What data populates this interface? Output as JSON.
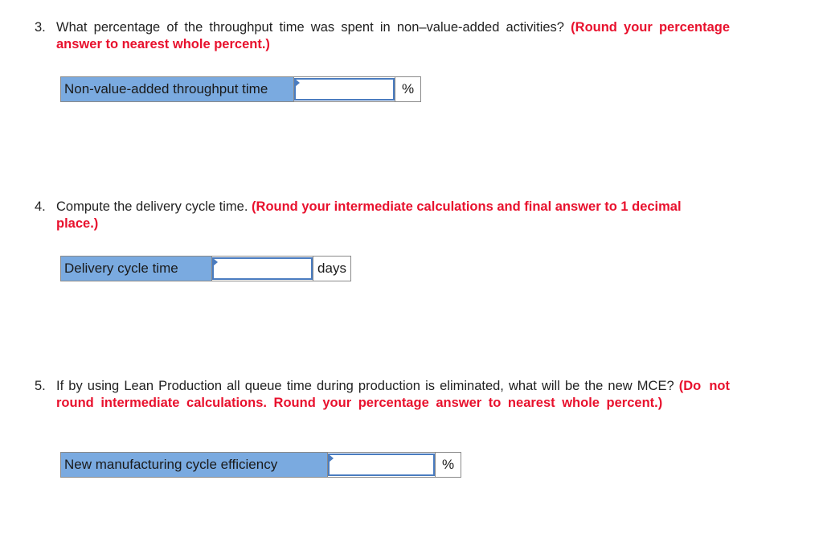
{
  "questions": [
    {
      "number": "3.",
      "text": "What percentage of the throughput time was spent in non–value-added activities?",
      "instruction": "(Round your percentage answer to nearest whole percent.)",
      "answer_row": {
        "label": "Non-value-added throughput time",
        "value": "",
        "unit": "%"
      }
    },
    {
      "number": "4.",
      "text": "Compute the delivery cycle time.",
      "instruction": "(Round your intermediate calculations and final answer to 1 decimal place.)",
      "answer_row": {
        "label": "Delivery cycle time",
        "value": "",
        "unit": "days"
      }
    },
    {
      "number": "5.",
      "text": "If by using Lean Production all queue time during production is eliminated, what will be the new MCE?",
      "instruction": "(Do not round intermediate calculations. Round your percentage answer to nearest whole percent.)",
      "answer_row": {
        "label": "New manufacturing cycle efficiency",
        "value": "",
        "unit": "%"
      }
    }
  ],
  "colors": {
    "instruction_red": "#e8112d",
    "label_fill": "#7aaae0",
    "input_border": "#4a7cc0"
  }
}
